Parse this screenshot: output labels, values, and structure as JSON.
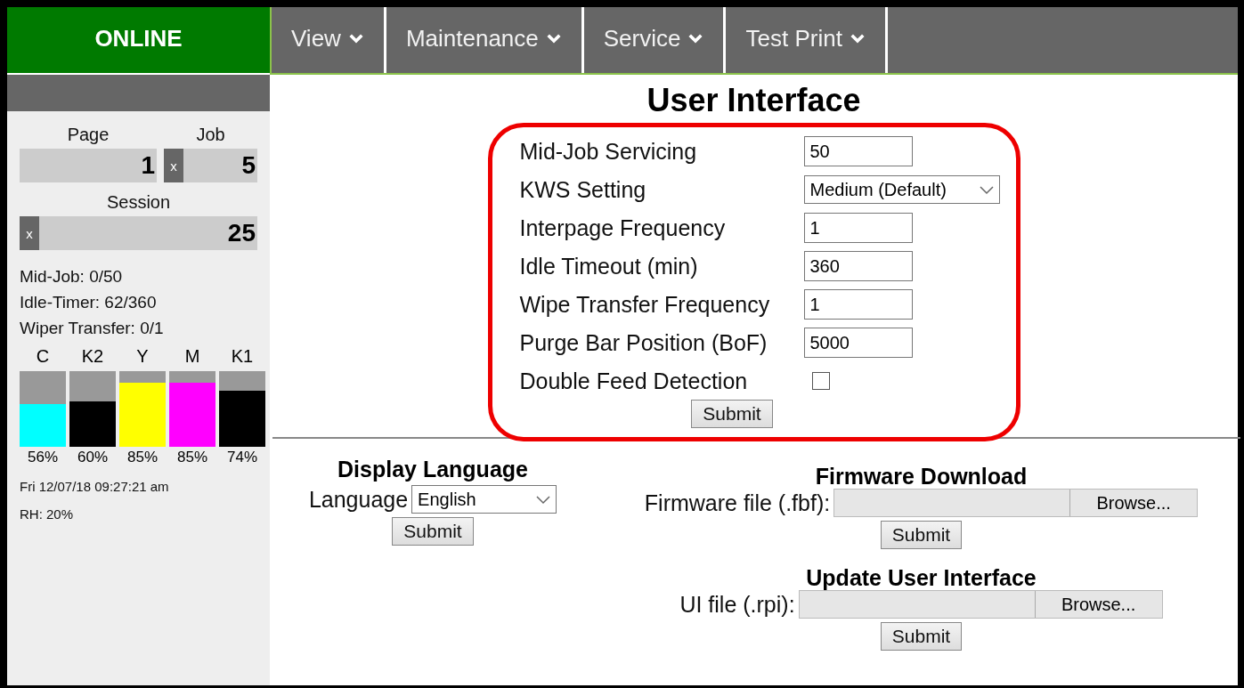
{
  "status": "ONLINE",
  "menu": [
    {
      "label": "View"
    },
    {
      "label": "Maintenance"
    },
    {
      "label": "Service"
    },
    {
      "label": "Test Print"
    }
  ],
  "counters": {
    "page_label": "Page",
    "page_value": "1",
    "job_label": "Job",
    "job_clear": "x",
    "job_value": "5",
    "session_label": "Session",
    "session_clear": "x",
    "session_value": "25"
  },
  "stats": [
    "Mid-Job: 0/50",
    "Idle-Timer: 62/360",
    "Wiper Transfer: 0/1"
  ],
  "inks": [
    {
      "name": "C",
      "color": "#00ffff",
      "level": 0.56,
      "percent": "56%"
    },
    {
      "name": "K2",
      "color": "#000000",
      "level": 0.6,
      "percent": "60%"
    },
    {
      "name": "Y",
      "color": "#ffff00",
      "level": 0.85,
      "percent": "85%"
    },
    {
      "name": "M",
      "color": "#ff00ff",
      "level": 0.85,
      "percent": "85%"
    },
    {
      "name": "K1",
      "color": "#000000",
      "level": 0.74,
      "percent": "74%"
    }
  ],
  "datetime": "Fri 12/07/18 09:27:21 am",
  "humidity": "RH: 20%",
  "title": "User Interface",
  "settings": {
    "fields": [
      {
        "kind": "text",
        "label": "Mid-Job Servicing",
        "value": "50"
      },
      {
        "kind": "select",
        "label": "KWS Setting",
        "value": "Medium (Default)"
      },
      {
        "kind": "text",
        "label": "Interpage Frequency",
        "value": "1"
      },
      {
        "kind": "text",
        "label": "Idle Timeout (min)",
        "value": "360"
      },
      {
        "kind": "text",
        "label": "Wipe Transfer Frequency",
        "value": "1"
      },
      {
        "kind": "text",
        "label": "Purge Bar Position (BoF)",
        "value": "5000"
      },
      {
        "kind": "checkbox",
        "label": "Double Feed Detection",
        "checked": false
      }
    ],
    "submit": "Submit"
  },
  "display_language": {
    "title": "Display Language",
    "label": "Language",
    "value": "English",
    "submit": "Submit"
  },
  "firmware": {
    "title": "Firmware Download",
    "label": "Firmware file (.fbf):",
    "browse": "Browse...",
    "submit": "Submit"
  },
  "ui_update": {
    "title": "Update User Interface",
    "label": "UI file (.rpi):",
    "browse": "Browse...",
    "submit": "Submit"
  }
}
